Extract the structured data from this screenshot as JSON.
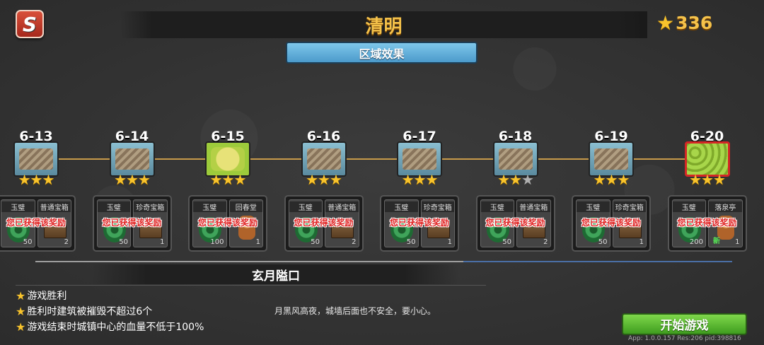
{
  "header": {
    "back_icon": "s-back-icon",
    "title": "清明",
    "star_total": "336"
  },
  "area_button": "区域效果",
  "claimed_text": "您已获得该奖励",
  "levels": [
    {
      "id": "6-13",
      "thumb": "blue",
      "stars": [
        1,
        1,
        1
      ],
      "rewards": [
        {
          "type": "jade",
          "name": "玉璧",
          "count": "50"
        },
        {
          "type": "chest",
          "name": "普通宝箱",
          "count": "2"
        }
      ]
    },
    {
      "id": "6-14",
      "thumb": "blue",
      "stars": [
        1,
        1,
        1
      ],
      "rewards": [
        {
          "type": "jade",
          "name": "玉璧",
          "count": "50"
        },
        {
          "type": "chest",
          "name": "珍奇宝箱",
          "count": "1"
        }
      ]
    },
    {
      "id": "6-15",
      "thumb": "green",
      "stars": [
        1,
        1,
        1
      ],
      "rewards": [
        {
          "type": "jade",
          "name": "玉璧",
          "count": "100"
        },
        {
          "type": "char",
          "name": "回春堂",
          "count": "1"
        }
      ]
    },
    {
      "id": "6-16",
      "thumb": "blue",
      "stars": [
        1,
        1,
        1
      ],
      "rewards": [
        {
          "type": "jade",
          "name": "玉璧",
          "count": "50"
        },
        {
          "type": "chest",
          "name": "普通宝箱",
          "count": "2"
        }
      ]
    },
    {
      "id": "6-17",
      "thumb": "blue",
      "stars": [
        1,
        1,
        1
      ],
      "rewards": [
        {
          "type": "jade",
          "name": "玉璧",
          "count": "50"
        },
        {
          "type": "chest",
          "name": "珍奇宝箱",
          "count": "1"
        }
      ]
    },
    {
      "id": "6-18",
      "thumb": "blue",
      "stars": [
        1,
        1,
        0
      ],
      "rewards": [
        {
          "type": "jade",
          "name": "玉璧",
          "count": "50"
        },
        {
          "type": "chest",
          "name": "普通宝箱",
          "count": "2"
        }
      ]
    },
    {
      "id": "6-19",
      "thumb": "blue",
      "stars": [
        1,
        1,
        1
      ],
      "rewards": [
        {
          "type": "jade",
          "name": "玉璧",
          "count": "50"
        },
        {
          "type": "chest",
          "name": "珍奇宝箱",
          "count": "1"
        }
      ]
    },
    {
      "id": "6-20",
      "thumb": "boss",
      "stars": [
        1,
        1,
        1
      ],
      "rewards": [
        {
          "type": "jade",
          "name": "玉璧",
          "count": "200"
        },
        {
          "type": "char",
          "name": "落泉亭",
          "count": "1",
          "tag": "新"
        }
      ]
    }
  ],
  "stage": {
    "name": "玄月隘口",
    "objectives": [
      "游戏胜利",
      "胜利时建筑被摧毁不超过6个",
      "游戏结束时城镇中心的血量不低于100%"
    ],
    "description": "月黑风高夜，城墙后面也不安全，要小心。"
  },
  "start_button": "开始游戏",
  "version_text": "App: 1.0.0.157 Res:206 pid:398816",
  "colors": {
    "title_gold": "#f5c24a",
    "star_gold": "#f8c32c",
    "area_blue": "#5aa8d8",
    "start_green": "#5cbf35",
    "claimed_red": "#e02222",
    "boss_border": "#d52626"
  }
}
